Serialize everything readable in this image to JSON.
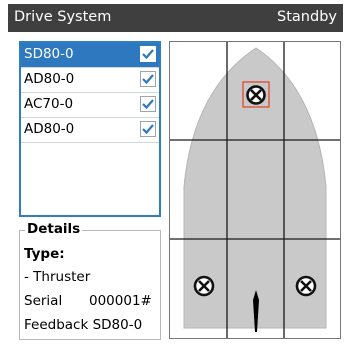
{
  "titlebar": {
    "title": "Drive System",
    "status": "Standby"
  },
  "devices": [
    {
      "name": "SD80-0",
      "checked": true,
      "selected": true
    },
    {
      "name": "AD80-0",
      "checked": true,
      "selected": false
    },
    {
      "name": "AC70-0",
      "checked": true,
      "selected": false
    },
    {
      "name": "AD80-0",
      "checked": true,
      "selected": false
    }
  ],
  "details": {
    "legend": "Details",
    "type_label": "Type:",
    "type_value": "- Thruster",
    "serial_label": "Serial",
    "serial_value": "000001#",
    "feedback_label": "Feedback SD80-0"
  },
  "boat_view": {
    "hull_color": "#c9c9c9",
    "grid_color": "#1a1a1a",
    "selection_color": "#e04020",
    "icons": [
      "bow-thruster-icon",
      "port-stern-thruster-icon",
      "starboard-stern-thruster-icon",
      "rudder-icon"
    ]
  },
  "colors": {
    "titlebar": "#3f3f3f",
    "selection": "#2d78bf",
    "check": "#2d78bf"
  }
}
